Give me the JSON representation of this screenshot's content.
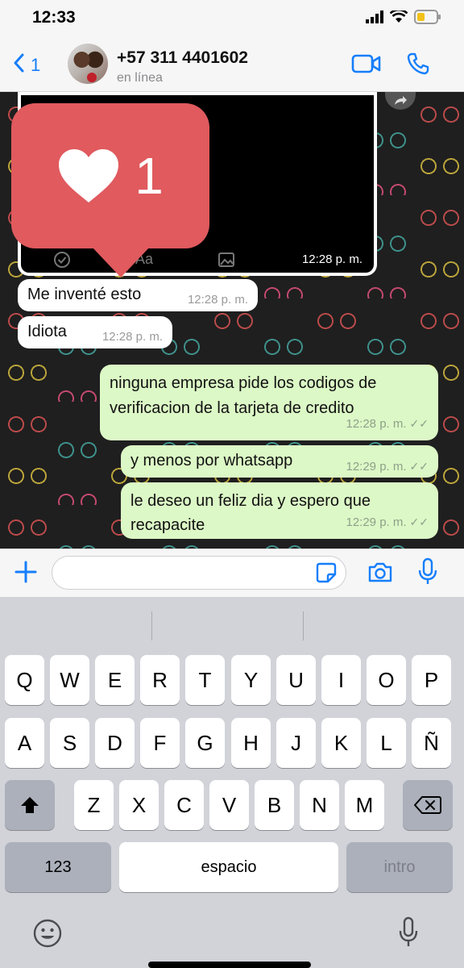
{
  "status_bar": {
    "time": "12:33"
  },
  "header": {
    "back_count": "1",
    "contact_name": "+57 311 4401602",
    "contact_status": "en línea"
  },
  "image_message": {
    "time": "12:28 p. m.",
    "toolbar_label": "Aa"
  },
  "like_badge": {
    "count": "1"
  },
  "messages": [
    {
      "direction": "in",
      "text": "Me inventé esto",
      "time": "12:28 p. m."
    },
    {
      "direction": "in",
      "text": "Idiota",
      "time": "12:28 p. m."
    },
    {
      "direction": "out",
      "line1": "ninguna empresa pide los codigos de",
      "line2": "verificacion de la tarjeta de credito",
      "time": "12:28 p. m."
    },
    {
      "direction": "out",
      "text": "y menos por whatsapp",
      "time": "12:29 p. m."
    },
    {
      "direction": "out",
      "line1": "le deseo un feliz dia y espero que",
      "line2": "recapacite",
      "time": "12:29 p. m."
    }
  ],
  "composer": {
    "input_value": ""
  },
  "keyboard": {
    "row1": [
      "Q",
      "W",
      "E",
      "R",
      "T",
      "Y",
      "U",
      "I",
      "O",
      "P"
    ],
    "row2": [
      "A",
      "S",
      "D",
      "F",
      "G",
      "H",
      "J",
      "K",
      "L",
      "Ñ"
    ],
    "row3": [
      "Z",
      "X",
      "C",
      "V",
      "B",
      "N",
      "M"
    ],
    "numbers_key": "123",
    "space_key": "espacio",
    "return_key": "intro"
  },
  "colors": {
    "accent": "#157efb",
    "outgoing_bubble": "#dcf8c6",
    "incoming_bubble": "#ffffff",
    "like_badge": "#e05a5e"
  }
}
